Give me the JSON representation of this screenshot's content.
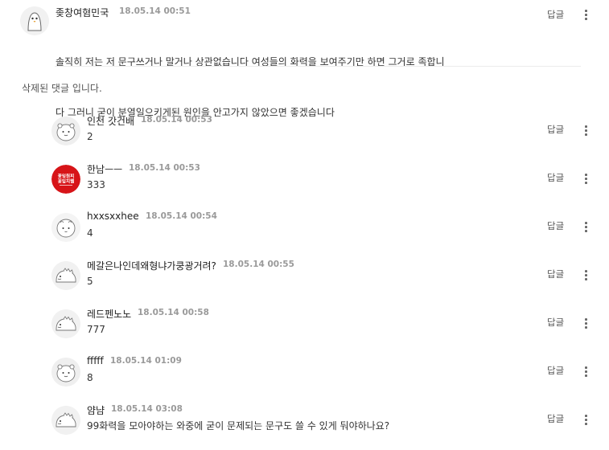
{
  "top_comment": {
    "nick": "좆창여혐민국",
    "date": "18.05.14 00:51",
    "lines": [
      "솔직히 저는 저 문구쓰거나 말거나 상관없습니다 여성들의 화력을 보여주기만 하면 그거로 족합니",
      "다 그러니 굳이 분열일으키게된 원인을 안고가지 않았으면 좋겠습니다"
    ],
    "reply_label": "답글"
  },
  "deleted_text": "삭제된 댓글 입니다.",
  "badge_texts": [
    "꽃잎원피",
    "꽃잎치웹"
  ],
  "replies": [
    {
      "nick": "인천 갓건배",
      "date": "18.05.14 00:53",
      "text": "2",
      "reply_label": "답글",
      "avatar": "ghost-bear"
    },
    {
      "nick": "한남ㅡㅡ",
      "date": "18.05.14 00:53",
      "text": "333",
      "reply_label": "답글",
      "avatar": "red-badge"
    },
    {
      "nick": "hxxsxxhee",
      "date": "18.05.14 00:54",
      "text": "4",
      "reply_label": "답글",
      "avatar": "round-face"
    },
    {
      "nick": "메갈은나인데왜형냐가쿵광거려?",
      "date": "18.05.14 00:55",
      "text": "5",
      "reply_label": "답글",
      "avatar": "dino"
    },
    {
      "nick": "레드펜노노",
      "date": "18.05.14 00:58",
      "text": "777",
      "reply_label": "답글",
      "avatar": "dino"
    },
    {
      "nick": "fffff",
      "date": "18.05.14 01:09",
      "text": "8",
      "reply_label": "답글",
      "avatar": "ghost-bear"
    },
    {
      "nick": "얌냠",
      "date": "18.05.14 03:08",
      "text": "99화력을 모아야하는 와중에 굳이 문제되는 문구도 쓸 수 있게 둬야하나요?",
      "reply_label": "답글",
      "avatar": "dino"
    }
  ]
}
